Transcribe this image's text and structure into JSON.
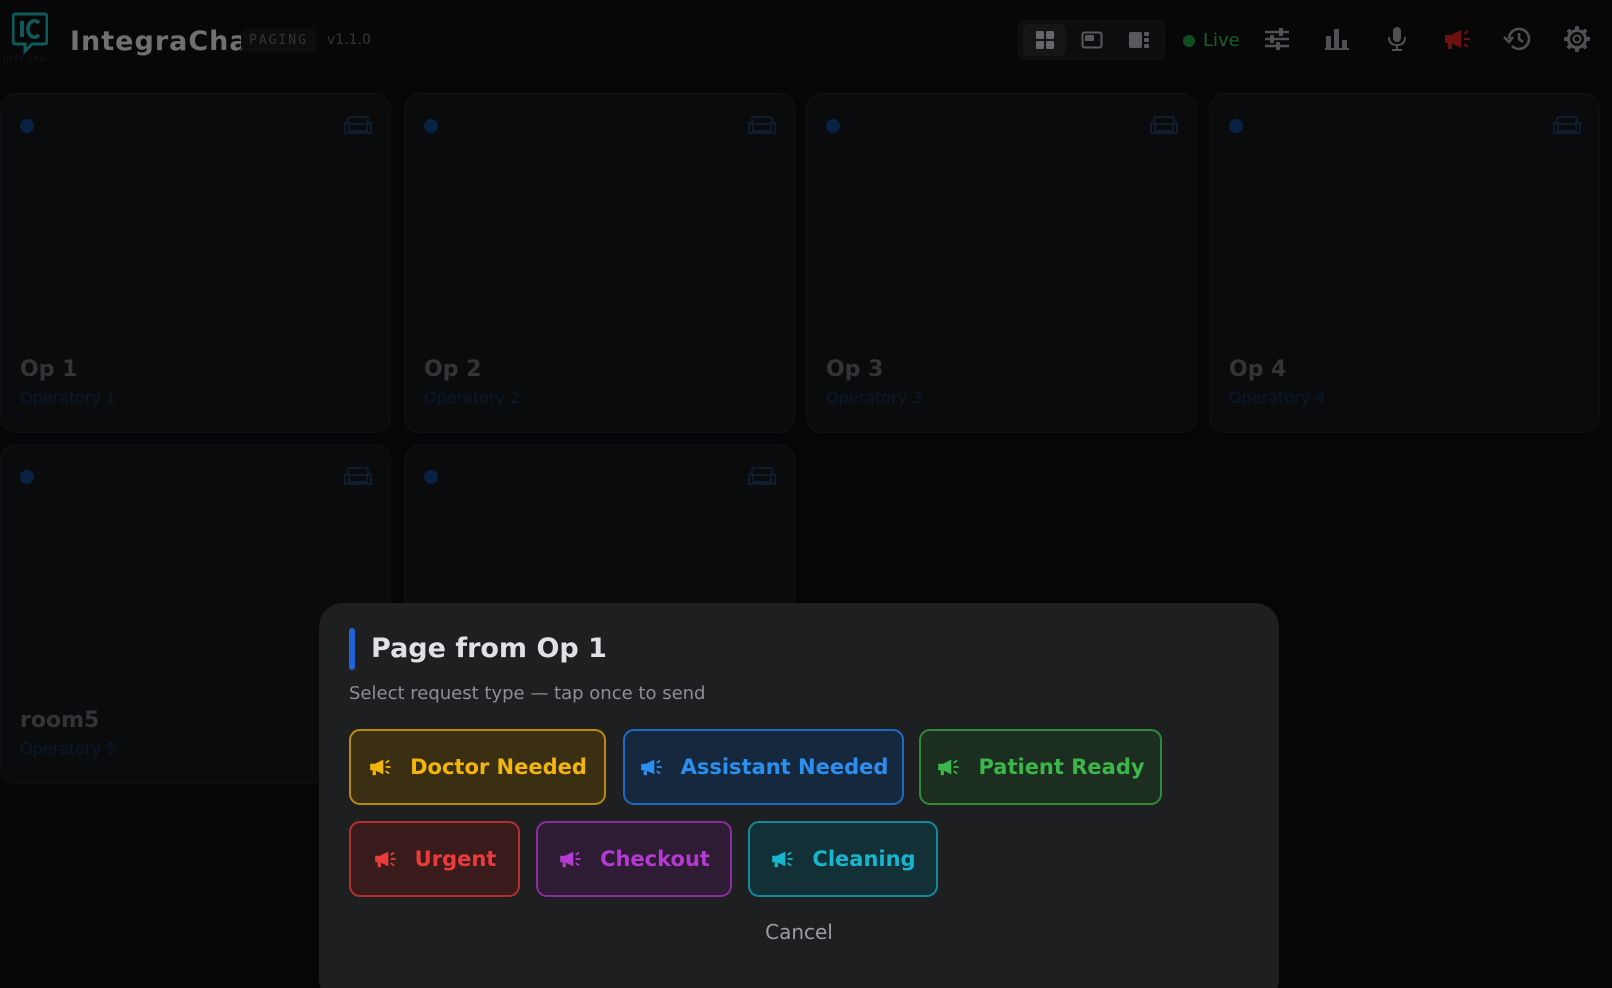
{
  "app": {
    "brand": "IntegraChat",
    "mode_badge": "PAGING",
    "version": "v1.1.0",
    "logo_sub": "INTEGRA"
  },
  "header": {
    "status_label": "Live",
    "layout_options": [
      "grid-layout-icon",
      "picture-in-picture-layout-icon",
      "sidebar-layout-icon"
    ],
    "tools": [
      "sliders-icon",
      "bar-chart-icon",
      "microphone-icon",
      "megaphone-icon",
      "history-icon",
      "gear-icon"
    ],
    "colors": {
      "live": "#2fae4e",
      "megaphone": "#c81e1e"
    }
  },
  "operatories": [
    {
      "name": "Op 1",
      "subtitle": "Operatory 1"
    },
    {
      "name": "Op 2",
      "subtitle": "Operatory 2"
    },
    {
      "name": "Op 3",
      "subtitle": "Operatory 3"
    },
    {
      "name": "Op 4",
      "subtitle": "Operatory 4"
    },
    {
      "name": "room5",
      "subtitle": "Operatory 5"
    },
    {
      "name": "",
      "subtitle": ""
    }
  ],
  "modal": {
    "title": "Page from Op 1",
    "subtitle": "Select request type — tap once to send",
    "buttons": [
      {
        "label": "Doctor Needed",
        "color": "#f2b50c"
      },
      {
        "label": "Assistant Needed",
        "color": "#2b8ff0"
      },
      {
        "label": "Patient Ready",
        "color": "#3cb64a"
      },
      {
        "label": "Urgent",
        "color": "#ec3b3b"
      },
      {
        "label": "Checkout",
        "color": "#b43ad1"
      },
      {
        "label": "Cleaning",
        "color": "#16b6cf"
      }
    ],
    "cancel_label": "Cancel"
  }
}
